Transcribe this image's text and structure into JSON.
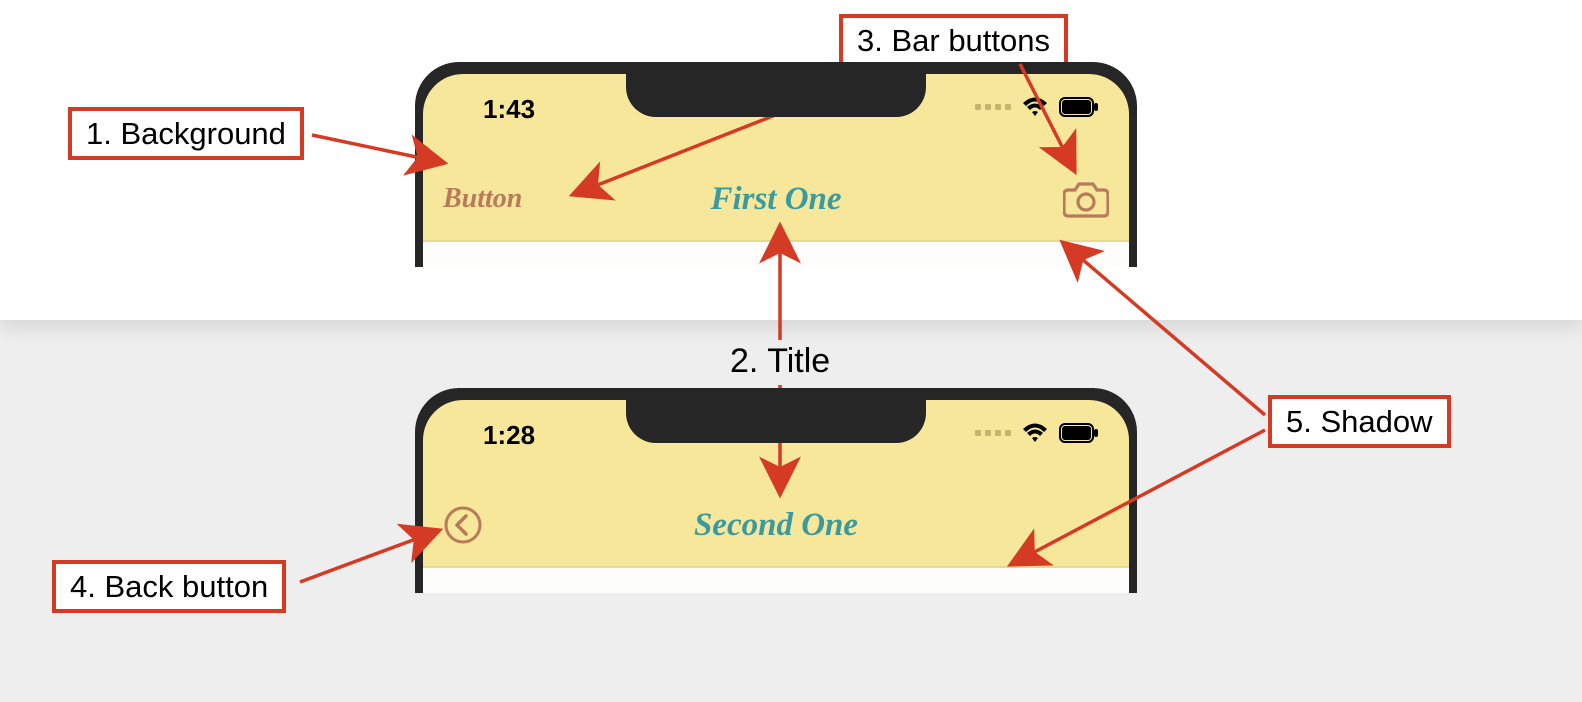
{
  "annotations": {
    "background": "1. Background",
    "title": "2. Title",
    "bar_buttons": "3. Bar buttons",
    "back_button": "4. Back button",
    "shadow": "5. Shadow"
  },
  "phone1": {
    "status_time": "1:43",
    "nav_left_button_label": "Button",
    "nav_title": "First One"
  },
  "phone2": {
    "status_time": "1:28",
    "nav_title": "Second One"
  },
  "colors": {
    "nav_background": "#f7e79b",
    "title_tint": "#3a9aa0",
    "button_tint": "#b97a5a",
    "annotation_border": "#d43a24"
  }
}
